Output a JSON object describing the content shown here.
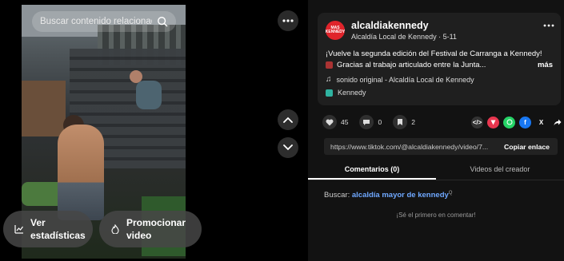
{
  "video": {
    "search_placeholder": "Buscar contenido relacionado",
    "stats_label_1": "Ver",
    "stats_label_2": "estadísticas",
    "promo_label_1": "Promocionar",
    "promo_label_2": "video"
  },
  "author": {
    "avatar_text": "MAS KENNEDY",
    "username": "alcaldiakennedy",
    "subtitle": "Alcaldía Local de Kennedy · 5-11"
  },
  "description": {
    "line1": "¡Vuelve la segunda edición del Festival de Carranga a Kennedy!",
    "line2": "Gracias al trabajo articulado entre la Junta...",
    "more": "más"
  },
  "sound": "sonido original - Alcaldía Local de Kennedy",
  "location": "Kennedy",
  "stats": {
    "likes": "45",
    "comments": "0",
    "saves": "2"
  },
  "share": {
    "embed": "</>",
    "x": "X"
  },
  "link": {
    "url": "https://www.tiktok.com/@alcaldiakennedy/video/7...",
    "copy": "Copiar enlace"
  },
  "tabs": [
    {
      "label": "Comentarios (0)",
      "active": true
    },
    {
      "label": "Videos del creador",
      "active": false
    }
  ],
  "related": {
    "prefix": "Buscar: ",
    "query": "alcaldía mayor de kennedy"
  },
  "empty_comments": "¡Sé el primero en comentar!",
  "colors": {
    "accent": "#e0242b",
    "link": "#6fa8ff",
    "background": "#000000",
    "panel": "#121212"
  }
}
